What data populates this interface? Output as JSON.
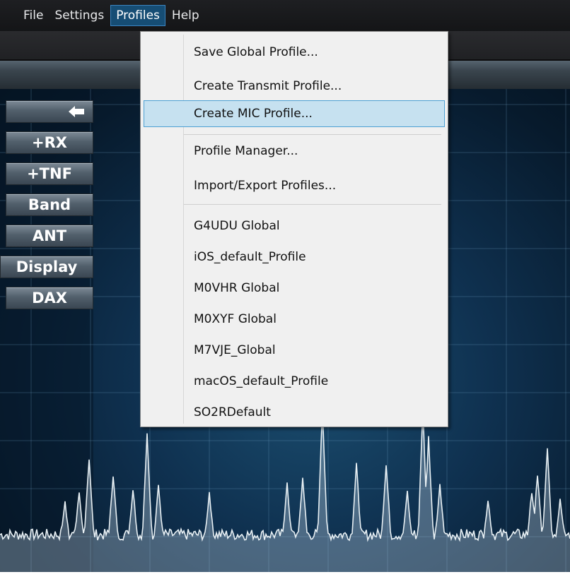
{
  "menubar": {
    "items": [
      "File",
      "Settings",
      "Profiles",
      "Help"
    ],
    "active_index": 2
  },
  "sidebar": {
    "back_icon": "left-arrow-icon",
    "buttons": [
      "+RX",
      "+TNF",
      "Band",
      "ANT",
      "Display",
      "DAX"
    ]
  },
  "profiles_menu": {
    "group1": [
      "Save Global Profile...",
      "Create Transmit Profile...",
      "Create MIC Profile..."
    ],
    "group2": [
      "Profile Manager...",
      "Import/Export Profiles..."
    ],
    "profiles": [
      "G4UDU Global",
      "iOS_default_Profile",
      "M0VHR Global",
      "M0XYF Global",
      "M7VJE_Global",
      "macOS_default_Profile",
      "SO2RDefault"
    ],
    "highlighted_item": "Create MIC Profile..."
  },
  "colors": {
    "menu_active_bg": "#164d74",
    "highlight_bg": "#c6e1f0",
    "highlight_border": "#4da0d3",
    "spectrum_trace": "#e8f0f4"
  }
}
